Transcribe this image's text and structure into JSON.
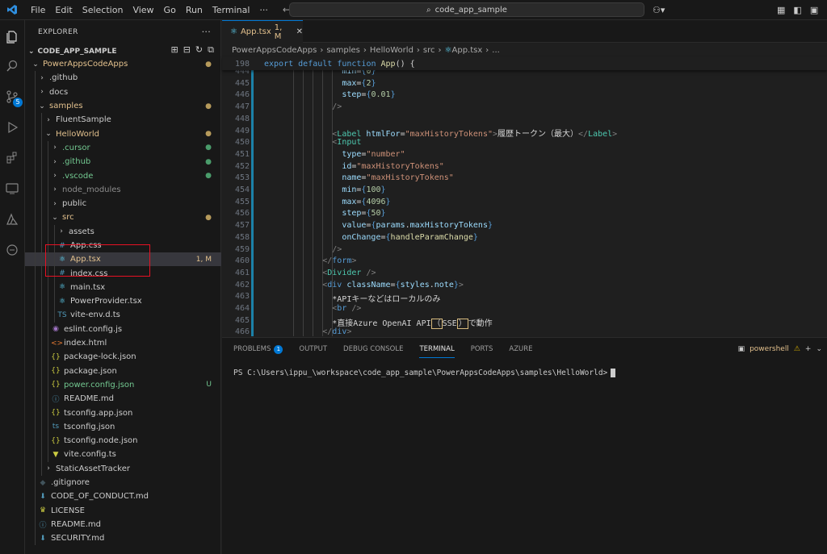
{
  "menu": [
    "File",
    "Edit",
    "Selection",
    "View",
    "Go",
    "Run",
    "Terminal",
    "···"
  ],
  "search": {
    "text": "code_app_sample"
  },
  "explorer": {
    "title": "EXPLORER",
    "more": "···",
    "section": "CODE_APP_SAMPLE",
    "items": [
      {
        "label": "PowerAppsCodeApps",
        "depth": 0,
        "chev": "down",
        "icon": "",
        "cls": "yellow",
        "status": "●",
        "scls": "dot"
      },
      {
        "label": ".github",
        "depth": 1,
        "chev": "right",
        "icon": "",
        "cls": "",
        "status": "",
        "scls": ""
      },
      {
        "label": "docs",
        "depth": 1,
        "chev": "right",
        "icon": "",
        "cls": "",
        "status": "",
        "scls": ""
      },
      {
        "label": "samples",
        "depth": 1,
        "chev": "down",
        "icon": "",
        "cls": "yellow",
        "status": "●",
        "scls": "dot"
      },
      {
        "label": "FluentSample",
        "depth": 2,
        "chev": "right",
        "icon": "",
        "cls": "",
        "status": "",
        "scls": ""
      },
      {
        "label": "HelloWorld",
        "depth": 2,
        "chev": "down",
        "icon": "",
        "cls": "yellow",
        "status": "●",
        "scls": "dot"
      },
      {
        "label": ".cursor",
        "depth": 3,
        "chev": "right",
        "icon": "",
        "cls": "green",
        "status": "●",
        "scls": "dotg"
      },
      {
        "label": ".github",
        "depth": 3,
        "chev": "right",
        "icon": "",
        "cls": "green",
        "status": "●",
        "scls": "dotg"
      },
      {
        "label": ".vscode",
        "depth": 3,
        "chev": "right",
        "icon": "",
        "cls": "green",
        "status": "●",
        "scls": "dotg"
      },
      {
        "label": "node_modules",
        "depth": 3,
        "chev": "right",
        "icon": "",
        "cls": "dim",
        "status": "",
        "scls": ""
      },
      {
        "label": "public",
        "depth": 3,
        "chev": "right",
        "icon": "",
        "cls": "",
        "status": "",
        "scls": ""
      },
      {
        "label": "src",
        "depth": 3,
        "chev": "down",
        "icon": "",
        "cls": "yellow",
        "status": "●",
        "scls": "dot"
      },
      {
        "label": "assets",
        "depth": 4,
        "chev": "right",
        "icon": "",
        "cls": "",
        "status": "",
        "scls": ""
      },
      {
        "label": "App.css",
        "depth": 4,
        "chev": "",
        "icon": "#",
        "cls": "",
        "status": "",
        "scls": ""
      },
      {
        "label": "App.tsx",
        "depth": 4,
        "chev": "",
        "icon": "⚛",
        "cls": "yellow",
        "status": "1, M",
        "scls": "yellow",
        "selected": true
      },
      {
        "label": "index.css",
        "depth": 4,
        "chev": "",
        "icon": "#",
        "cls": "",
        "status": "",
        "scls": ""
      },
      {
        "label": "main.tsx",
        "depth": 4,
        "chev": "",
        "icon": "⚛",
        "cls": "",
        "status": "",
        "scls": ""
      },
      {
        "label": "PowerProvider.tsx",
        "depth": 4,
        "chev": "",
        "icon": "⚛",
        "cls": "",
        "status": "",
        "scls": ""
      },
      {
        "label": "vite-env.d.ts",
        "depth": 4,
        "chev": "",
        "icon": "TS",
        "cls": "",
        "status": "",
        "scls": ""
      },
      {
        "label": "eslint.config.js",
        "depth": 3,
        "chev": "",
        "icon": "◉",
        "cls": "",
        "status": "",
        "scls": ""
      },
      {
        "label": "index.html",
        "depth": 3,
        "chev": "",
        "icon": "<>",
        "cls": "",
        "status": "",
        "scls": ""
      },
      {
        "label": "package-lock.json",
        "depth": 3,
        "chev": "",
        "icon": "{}",
        "cls": "",
        "status": "",
        "scls": ""
      },
      {
        "label": "package.json",
        "depth": 3,
        "chev": "",
        "icon": "{}",
        "cls": "",
        "status": "",
        "scls": ""
      },
      {
        "label": "power.config.json",
        "depth": 3,
        "chev": "",
        "icon": "{}",
        "cls": "green",
        "status": "U",
        "scls": "green"
      },
      {
        "label": "README.md",
        "depth": 3,
        "chev": "",
        "icon": "ⓘ",
        "cls": "",
        "status": "",
        "scls": ""
      },
      {
        "label": "tsconfig.app.json",
        "depth": 3,
        "chev": "",
        "icon": "{}",
        "cls": "",
        "status": "",
        "scls": ""
      },
      {
        "label": "tsconfig.json",
        "depth": 3,
        "chev": "",
        "icon": "ts",
        "cls": "",
        "status": "",
        "scls": ""
      },
      {
        "label": "tsconfig.node.json",
        "depth": 3,
        "chev": "",
        "icon": "{}",
        "cls": "",
        "status": "",
        "scls": ""
      },
      {
        "label": "vite.config.ts",
        "depth": 3,
        "chev": "",
        "icon": "▼",
        "cls": "",
        "status": "",
        "scls": ""
      },
      {
        "label": "StaticAssetTracker",
        "depth": 2,
        "chev": "right",
        "icon": "",
        "cls": "",
        "status": "",
        "scls": ""
      },
      {
        "label": ".gitignore",
        "depth": 1,
        "chev": "",
        "icon": "◆",
        "cls": "",
        "status": "",
        "scls": ""
      },
      {
        "label": "CODE_OF_CONDUCT.md",
        "depth": 1,
        "chev": "",
        "icon": "⬇",
        "cls": "",
        "status": "",
        "scls": ""
      },
      {
        "label": "LICENSE",
        "depth": 1,
        "chev": "",
        "icon": "♛",
        "cls": "",
        "status": "",
        "scls": ""
      },
      {
        "label": "README.md",
        "depth": 1,
        "chev": "",
        "icon": "ⓘ",
        "cls": "",
        "status": "",
        "scls": ""
      },
      {
        "label": "SECURITY.md",
        "depth": 1,
        "chev": "",
        "icon": "⬇",
        "cls": "",
        "status": "",
        "scls": ""
      }
    ]
  },
  "tab": {
    "label": "App.tsx",
    "status": "1, M",
    "close": "✕"
  },
  "breadcrumb": [
    "PowerAppsCodeApps",
    "samples",
    "HelloWorld",
    "src",
    "App.tsx",
    "..."
  ],
  "sticky": {
    "line": "198",
    "code": [
      [
        "t-key",
        "export "
      ],
      [
        "t-key",
        "default "
      ],
      [
        "t-key",
        "function "
      ],
      [
        "t-fn",
        "App"
      ],
      [
        "t-txt",
        "() {"
      ]
    ]
  },
  "code_lines": [
    {
      "n": "444",
      "indent": 8,
      "tokens": [
        [
          "t-attr",
          "min"
        ],
        [
          "t-txt",
          "="
        ],
        [
          "t-brace",
          "{"
        ],
        [
          "t-num",
          "0"
        ],
        [
          "t-brace",
          "}"
        ]
      ]
    },
    {
      "n": "445",
      "indent": 8,
      "tokens": [
        [
          "t-attr",
          "max"
        ],
        [
          "t-txt",
          "="
        ],
        [
          "t-brace",
          "{"
        ],
        [
          "t-num",
          "2"
        ],
        [
          "t-brace",
          "}"
        ]
      ]
    },
    {
      "n": "446",
      "indent": 8,
      "tokens": [
        [
          "t-attr",
          "step"
        ],
        [
          "t-txt",
          "="
        ],
        [
          "t-brace",
          "{"
        ],
        [
          "t-num",
          "0.01"
        ],
        [
          "t-brace",
          "}"
        ]
      ]
    },
    {
      "n": "447",
      "indent": 7,
      "tokens": [
        [
          "t-pun",
          "/>"
        ]
      ]
    },
    {
      "n": "448",
      "indent": 0,
      "tokens": []
    },
    {
      "n": "449",
      "indent": 7,
      "tokens": [
        [
          "t-pun",
          "<"
        ],
        [
          "t-cmp",
          "Label "
        ],
        [
          "t-attr",
          "htmlFor"
        ],
        [
          "t-txt",
          "="
        ],
        [
          "t-str",
          "\"maxHistoryTokens\""
        ],
        [
          "t-pun",
          ">"
        ],
        [
          "t-txt",
          "履歴トークン（最大）"
        ],
        [
          "t-pun",
          "</"
        ],
        [
          "t-cmp",
          "Label"
        ],
        [
          "t-pun",
          ">"
        ]
      ]
    },
    {
      "n": "450",
      "indent": 7,
      "tokens": [
        [
          "t-pun",
          "<"
        ],
        [
          "t-cmp",
          "Input"
        ]
      ]
    },
    {
      "n": "451",
      "indent": 8,
      "tokens": [
        [
          "t-attr",
          "type"
        ],
        [
          "t-txt",
          "="
        ],
        [
          "t-str",
          "\"number\""
        ]
      ]
    },
    {
      "n": "452",
      "indent": 8,
      "tokens": [
        [
          "t-attr",
          "id"
        ],
        [
          "t-txt",
          "="
        ],
        [
          "t-str",
          "\"maxHistoryTokens\""
        ]
      ]
    },
    {
      "n": "453",
      "indent": 8,
      "tokens": [
        [
          "t-attr",
          "name"
        ],
        [
          "t-txt",
          "="
        ],
        [
          "t-str",
          "\"maxHistoryTokens\""
        ]
      ]
    },
    {
      "n": "454",
      "indent": 8,
      "tokens": [
        [
          "t-attr",
          "min"
        ],
        [
          "t-txt",
          "="
        ],
        [
          "t-brace",
          "{"
        ],
        [
          "t-num",
          "100"
        ],
        [
          "t-brace",
          "}"
        ]
      ]
    },
    {
      "n": "455",
      "indent": 8,
      "tokens": [
        [
          "t-attr",
          "max"
        ],
        [
          "t-txt",
          "="
        ],
        [
          "t-brace",
          "{"
        ],
        [
          "t-num",
          "4096"
        ],
        [
          "t-brace",
          "}"
        ]
      ]
    },
    {
      "n": "456",
      "indent": 8,
      "tokens": [
        [
          "t-attr",
          "step"
        ],
        [
          "t-txt",
          "="
        ],
        [
          "t-brace",
          "{"
        ],
        [
          "t-num",
          "50"
        ],
        [
          "t-brace",
          "}"
        ]
      ]
    },
    {
      "n": "457",
      "indent": 8,
      "tokens": [
        [
          "t-attr",
          "value"
        ],
        [
          "t-txt",
          "="
        ],
        [
          "t-brace",
          "{"
        ],
        [
          "t-attr",
          "params"
        ],
        [
          "t-txt",
          "."
        ],
        [
          "t-attr",
          "maxHistoryTokens"
        ],
        [
          "t-brace",
          "}"
        ]
      ]
    },
    {
      "n": "458",
      "indent": 8,
      "tokens": [
        [
          "t-attr",
          "onChange"
        ],
        [
          "t-txt",
          "="
        ],
        [
          "t-brace",
          "{"
        ],
        [
          "t-fn",
          "handleParamChange"
        ],
        [
          "t-brace",
          "}"
        ]
      ]
    },
    {
      "n": "459",
      "indent": 7,
      "tokens": [
        [
          "t-pun",
          "/>"
        ]
      ]
    },
    {
      "n": "460",
      "indent": 6,
      "tokens": [
        [
          "t-pun",
          "</"
        ],
        [
          "t-tag",
          "form"
        ],
        [
          "t-pun",
          ">"
        ]
      ]
    },
    {
      "n": "461",
      "indent": 6,
      "tokens": [
        [
          "t-pun",
          "<"
        ],
        [
          "t-cmp",
          "Divider "
        ],
        [
          "t-pun",
          "/>"
        ]
      ]
    },
    {
      "n": "462",
      "indent": 6,
      "tokens": [
        [
          "t-pun",
          "<"
        ],
        [
          "t-tag",
          "div "
        ],
        [
          "t-attr",
          "className"
        ],
        [
          "t-txt",
          "="
        ],
        [
          "t-brace",
          "{"
        ],
        [
          "t-attr",
          "styles"
        ],
        [
          "t-txt",
          "."
        ],
        [
          "t-attr",
          "note"
        ],
        [
          "t-brace",
          "}"
        ],
        [
          "t-pun",
          ">"
        ]
      ]
    },
    {
      "n": "463",
      "indent": 7,
      "tokens": [
        [
          "t-txt",
          "*APIキーなどはローカルのみ"
        ]
      ]
    },
    {
      "n": "464",
      "indent": 7,
      "tokens": [
        [
          "t-pun",
          "<"
        ],
        [
          "t-tag",
          "br "
        ],
        [
          "t-pun",
          "/>"
        ]
      ]
    },
    {
      "n": "465",
      "indent": 7,
      "tokens": [
        [
          "t-txt",
          "*直接Azure OpenAI API"
        ],
        [
          "boxch",
          "（"
        ],
        [
          "t-txt",
          "SSE"
        ],
        [
          "boxch",
          "）"
        ],
        [
          "t-txt",
          "で動作"
        ]
      ]
    },
    {
      "n": "466",
      "indent": 6,
      "tokens": [
        [
          "t-pun",
          "</"
        ],
        [
          "t-tag",
          "div"
        ],
        [
          "t-pun",
          ">"
        ]
      ]
    }
  ],
  "panel": {
    "tabs": [
      "PROBLEMS",
      "OUTPUT",
      "DEBUG CONSOLE",
      "TERMINAL",
      "PORTS",
      "AZURE"
    ],
    "problems_count": "1",
    "active": "TERMINAL",
    "shell": "powershell",
    "prompt": "PS C:\\Users\\ippu_\\workspace\\code_app_sample\\PowerAppsCodeApps\\samples\\HelloWorld>"
  }
}
